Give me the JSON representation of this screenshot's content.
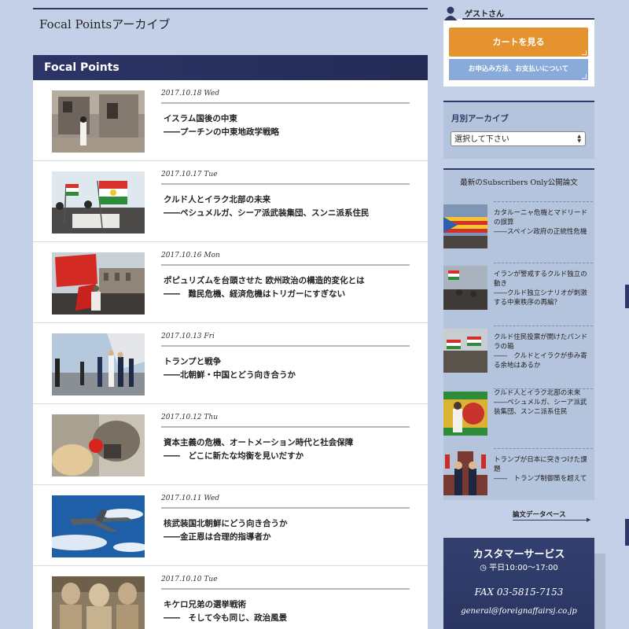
{
  "page": {
    "title": "Focal Pointsアーカイブ",
    "section_header": "Focal Points"
  },
  "articles": [
    {
      "date": "2017.10.18 Wed",
      "title": "イスラム国後の中東",
      "subtitle": "――プーチンの中東地政学戦略"
    },
    {
      "date": "2017.10.17 Tue",
      "title": "クルド人とイラク北部の未来",
      "subtitle": "――ペシュメルガ、シーア派武装集団、スンニ派系住民"
    },
    {
      "date": "2017.10.16 Mon",
      "title": "ポピュリズムを台頭させた 欧州政治の構造的変化とは",
      "subtitle": "――　難民危機、経済危機はトリガーにすぎない"
    },
    {
      "date": "2017.10.13 Fri",
      "title": "トランプと戦争",
      "subtitle": "――北朝鮮・中国とどう向き合うか"
    },
    {
      "date": "2017.10.12 Thu",
      "title": "資本主義の危機、オートメーション時代と社会保障",
      "subtitle": "――　どこに新たな均衡を見いだすか"
    },
    {
      "date": "2017.10.11 Wed",
      "title": "核武装国北朝鮮にどう向き合うか",
      "subtitle": "――金正恩は合理的指導者か"
    },
    {
      "date": "2017.10.10 Tue",
      "title": "キケロ兄弟の選挙戦術",
      "subtitle": "――　そして今も同じ、政治風景"
    }
  ],
  "sidebar": {
    "user_name": "ゲストさん",
    "cart_button": "カートを見る",
    "howto_button": "お申込み方法、お支払いについて",
    "archive_title": "月別アーカイブ",
    "archive_select": "選択して下さい",
    "latest_title": "最新のSubscribers Only公開論文",
    "latest": [
      {
        "title": "カタルーニャ危機とマドリードの誤算",
        "subtitle": "――スペイン政府の正統性危機"
      },
      {
        "title": "イランが警戒するクルド独立の動き",
        "subtitle": "――クルド独立シナリオが刺激する中東秩序の再編？"
      },
      {
        "title": "クルド住民投票が開けたパンドラの箱",
        "subtitle": "――　クルドとイラクが歩み寄る余地はあるか"
      },
      {
        "title": "クルド人とイラク北部の未来",
        "subtitle": "――ペシュメルガ、シーア派武装集団、スンニ派系住民"
      },
      {
        "title": "トランプが日本に突きつけた課題",
        "subtitle": "――　トランプ制御策を超えて"
      }
    ],
    "db_link": "論文データベース",
    "customer_service": {
      "title": "カスタマーサービス",
      "hours": "平日10:00～17:00",
      "fax": "FAX  03-5815-7153",
      "email": "general@foreignaffairsj.co.jp"
    }
  },
  "colors": {
    "background": "#c3d0e7",
    "navy": "#2d3567",
    "cart_orange": "#e4932e",
    "howto_blue": "#88abd9",
    "sidebar_panel": "#b5c4dd"
  },
  "icons": [
    "user-icon",
    "clock-icon",
    "arrow-right-icon",
    "select-arrows-icon"
  ]
}
